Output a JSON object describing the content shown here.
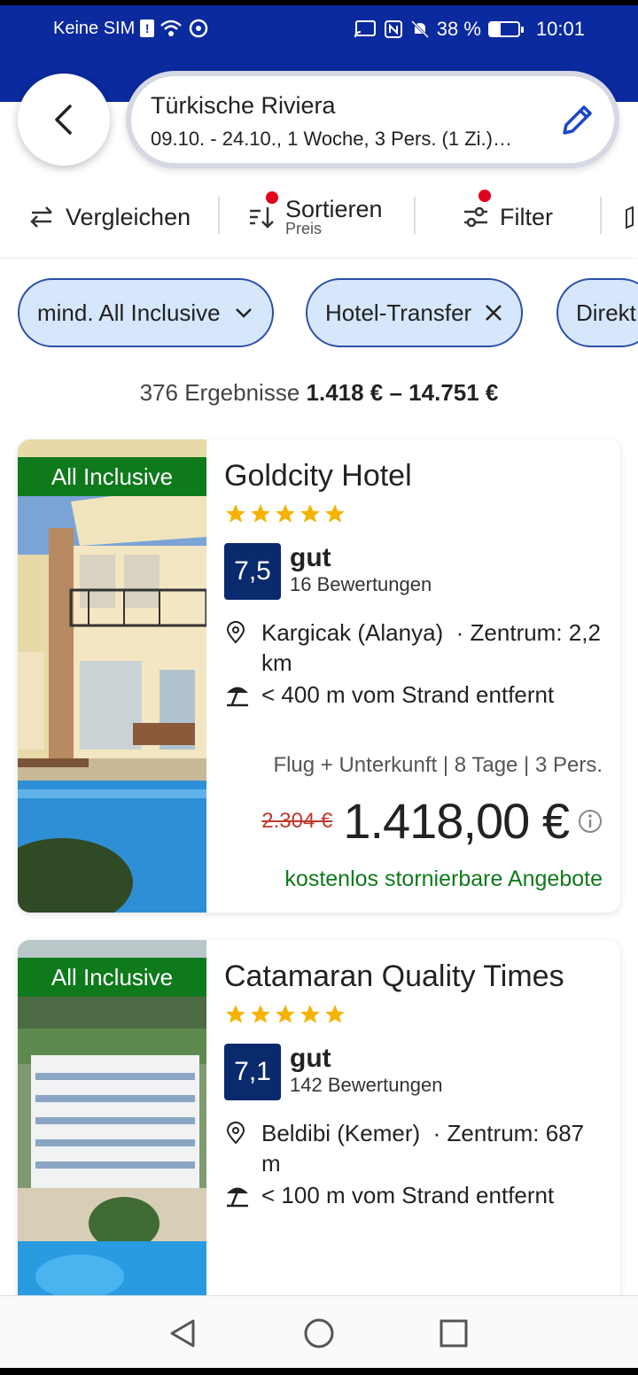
{
  "status_bar": {
    "carrier": "Keine SIM",
    "battery": "38 %",
    "battery_level": 0.38,
    "time": "10:01"
  },
  "search": {
    "destination": "Türkische Riviera",
    "details": "09.10. - 24.10., 1 Woche, 3 Pers. (1 Zi.)…"
  },
  "toolbar": {
    "compare_label": "Vergleichen",
    "sort_label": "Sortieren",
    "sort_sub": "Preis",
    "filter_label": "Filter"
  },
  "chips": [
    {
      "label": "mind. All Inclusive",
      "trail": "chevron-down-icon"
    },
    {
      "label": "Hotel-Transfer",
      "trail": "close-icon"
    },
    {
      "label": "Direkt"
    }
  ],
  "results": {
    "count": "376 Ergebnisse",
    "range": "1.418 € – 14.751 €"
  },
  "hotels": [
    {
      "board": "All Inclusive",
      "name": "Goldcity Hotel",
      "stars": 5,
      "rating": "7,5",
      "rating_word": "gut",
      "reviews": "16 Bewertungen",
      "location": "Kargicak (Alanya)",
      "center_distance": "· Zentrum: 2,2 km",
      "beach": "< 400 m vom Strand entfernt",
      "meta": "Flug + Unterkunft | 8 Tage | 3 Pers.",
      "price_old": "2.304 €",
      "price": "1.418,00 €",
      "cancel_note": "kostenlos stornierbare Angebote"
    },
    {
      "board": "All Inclusive",
      "name": "Catamaran Quality Times",
      "stars": 5,
      "rating": "7,1",
      "rating_word": "gut",
      "reviews": "142 Bewertungen",
      "location": "Beldibi (Kemer)",
      "center_distance": "· Zentrum: 687 m",
      "beach": "< 100 m vom Strand entfernt"
    }
  ],
  "colors": {
    "brand_blue": "#0a2a9e",
    "rating_box": "#0a2a6e",
    "badge_green": "#0e7a1b",
    "chip_bg": "#d6e6fb",
    "star": "#f5b301",
    "price_old": "#c0392b"
  }
}
